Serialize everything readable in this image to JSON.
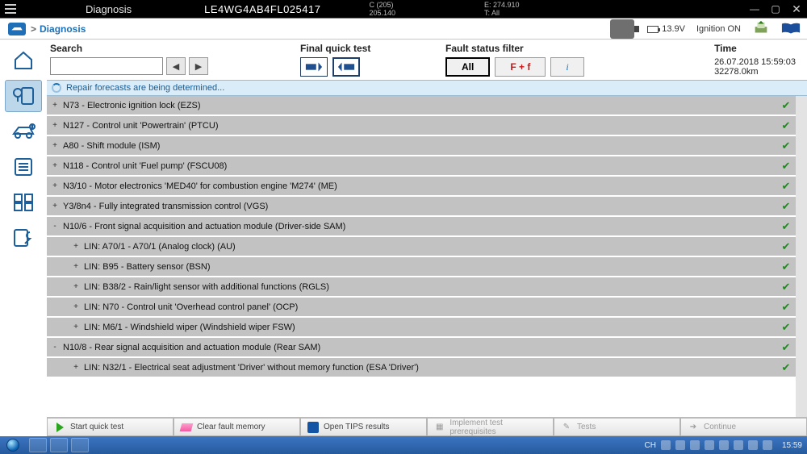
{
  "window": {
    "app_title": "Diagnosis",
    "vin": "LE4WG4AB4FL025417",
    "series_1": "C (205)",
    "series_2": "205.140",
    "extras_1": "E: 274.910",
    "extras_2": "T: All"
  },
  "breadcrumb": {
    "text": "Diagnosis",
    "battery_voltage": "13.9V",
    "ignition": "Ignition ON"
  },
  "filters": {
    "search_label": "Search",
    "search_value": "",
    "quick_test_label": "Final quick test",
    "fault_filter_label": "Fault status filter",
    "flt_all": "All",
    "flt_ff": "F + f",
    "flt_i": "i",
    "time_label": "Time",
    "timestamp": "26.07.2018 15:59:03",
    "odometer": "32278.0km"
  },
  "banner": "Repair forecasts are being determined...",
  "ecus": [
    {
      "expand": "+",
      "name": "N73 - Electronic ignition lock (EZS)",
      "ok": true
    },
    {
      "expand": "+",
      "name": "N127 - Control unit 'Powertrain' (PTCU)",
      "ok": true
    },
    {
      "expand": "+",
      "name": "A80 - Shift module (ISM)",
      "ok": true
    },
    {
      "expand": "+",
      "name": "N118 - Control unit 'Fuel pump' (FSCU08)",
      "ok": true
    },
    {
      "expand": "+",
      "name": "N3/10 - Motor electronics 'MED40' for combustion engine 'M274' (ME)",
      "ok": true
    },
    {
      "expand": "+",
      "name": "Y3/8n4 - Fully integrated transmission control (VGS)",
      "ok": true
    },
    {
      "expand": "-",
      "name": "N10/6 - Front signal acquisition and actuation module (Driver-side SAM)",
      "ok": true
    },
    {
      "expand": "+",
      "name": "LIN: A70/1 - A70/1 (Analog clock) (AU)",
      "ok": true,
      "sub": true
    },
    {
      "expand": "+",
      "name": "LIN: B95 - Battery sensor (BSN)",
      "ok": true,
      "sub": true
    },
    {
      "expand": "+",
      "name": "LIN: B38/2 - Rain/light sensor with additional functions (RGLS)",
      "ok": true,
      "sub": true
    },
    {
      "expand": "+",
      "name": "LIN: N70 - Control unit 'Overhead control panel' (OCP)",
      "ok": true,
      "sub": true
    },
    {
      "expand": "+",
      "name": "LIN: M6/1 - Windshield wiper (Windshield wiper FSW)",
      "ok": true,
      "sub": true
    },
    {
      "expand": "-",
      "name": "N10/8 - Rear signal acquisition and actuation module (Rear SAM)",
      "ok": true
    },
    {
      "expand": "+",
      "name": "LIN: N32/1 - Electrical seat adjustment 'Driver' without memory function (ESA 'Driver')",
      "ok": true,
      "sub": true
    }
  ],
  "toolbar": {
    "start": "Start quick test",
    "clear": "Clear fault memory",
    "tips": "Open TIPS results",
    "prereq": "Implement test prerequisites",
    "tests": "Tests",
    "continue": "Continue"
  },
  "taskbar": {
    "lang": "CH",
    "clock": "15:59"
  }
}
